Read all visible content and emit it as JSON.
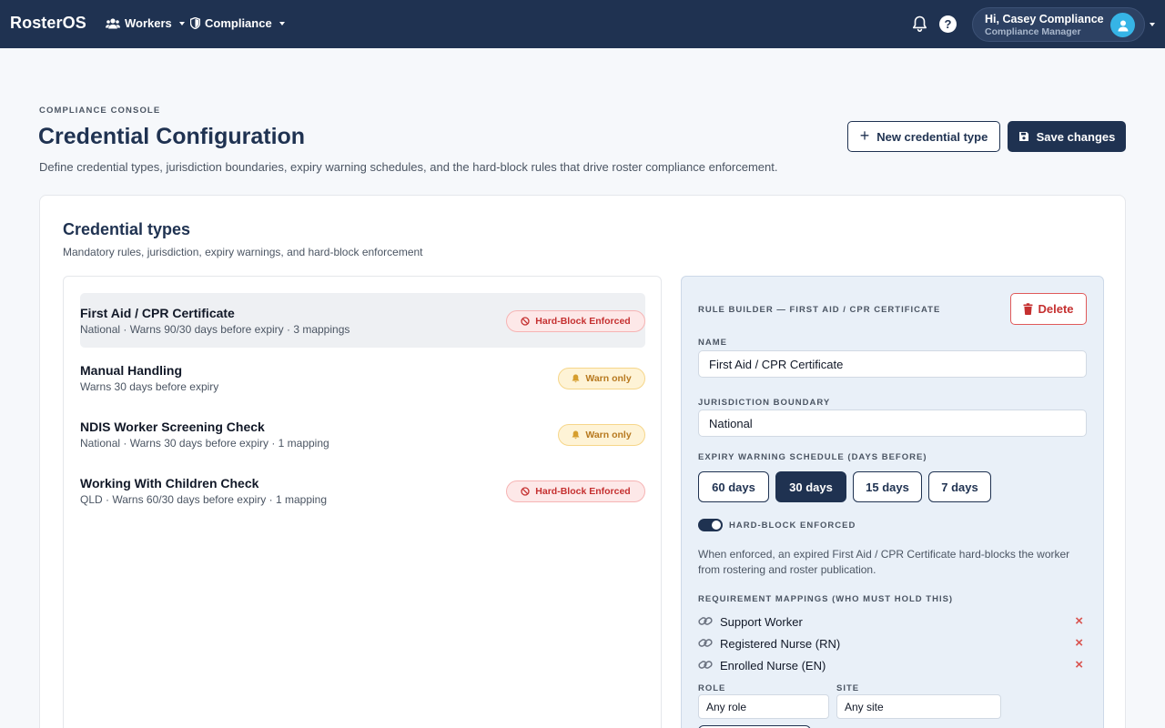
{
  "nav": {
    "brand": "RosterOS",
    "menus": [
      "Workers",
      "Compliance"
    ],
    "user": {
      "greeting": "Hi, Casey Compliance",
      "role": "Compliance Manager"
    }
  },
  "header": {
    "eyebrow": "COMPLIANCE CONSOLE",
    "title": "Credential Configuration",
    "description": "Define credential types, jurisdiction boundaries, expiry warning schedules, and the hard-block rules that drive roster compliance enforcement.",
    "new_button": "New credential type",
    "save_button": "Save changes"
  },
  "card": {
    "title": "Credential types",
    "subtitle": "Mandatory rules, jurisdiction, expiry warnings, and hard-block enforcement"
  },
  "credentials": [
    {
      "name": "First Aid / CPR Certificate",
      "meta": "National · Warns 90/30 days before expiry · 3 mappings",
      "badge": "Hard-Block Enforced",
      "badge_type": "hard",
      "selected": true
    },
    {
      "name": "Manual Handling",
      "meta": "Warns 30 days before expiry",
      "badge": "Warn only",
      "badge_type": "warn",
      "selected": false
    },
    {
      "name": "NDIS Worker Screening Check",
      "meta": "National · Warns 30 days before expiry · 1 mapping",
      "badge": "Warn only",
      "badge_type": "warn",
      "selected": false
    },
    {
      "name": "Working With Children Check",
      "meta": "QLD · Warns 60/30 days before expiry · 1 mapping",
      "badge": "Hard-Block Enforced",
      "badge_type": "hard",
      "selected": false
    }
  ],
  "rule_builder": {
    "title": "RULE BUILDER — FIRST AID / CPR CERTIFICATE",
    "delete_button": "Delete",
    "name_label": "NAME",
    "name_value": "First Aid / CPR Certificate",
    "jurisdiction_label": "JURISDICTION BOUNDARY",
    "jurisdiction_value": "National",
    "schedule_label": "EXPIRY WARNING SCHEDULE (DAYS BEFORE)",
    "schedule_options": [
      {
        "label": "60 days",
        "active": false
      },
      {
        "label": "30 days",
        "active": true
      },
      {
        "label": "15 days",
        "active": false
      },
      {
        "label": "7 days",
        "active": false
      }
    ],
    "hard_block_label": "HARD-BLOCK ENFORCED",
    "hard_block_on": true,
    "hard_block_note": "When enforced, an expired First Aid / CPR Certificate hard-blocks the worker from rostering and roster publication.",
    "mappings_label": "REQUIREMENT MAPPINGS (WHO MUST HOLD THIS)",
    "mappings": [
      "Support Worker",
      "Registered Nurse (RN)",
      "Enrolled Nurse (EN)"
    ],
    "role_label": "ROLE",
    "role_value": "Any role",
    "site_label": "SITE",
    "site_value": "Any site"
  },
  "colors": {
    "navy": "#1f3251",
    "danger": "#c53030",
    "warning": "#b7791f",
    "avatar": "#36b4e6"
  }
}
